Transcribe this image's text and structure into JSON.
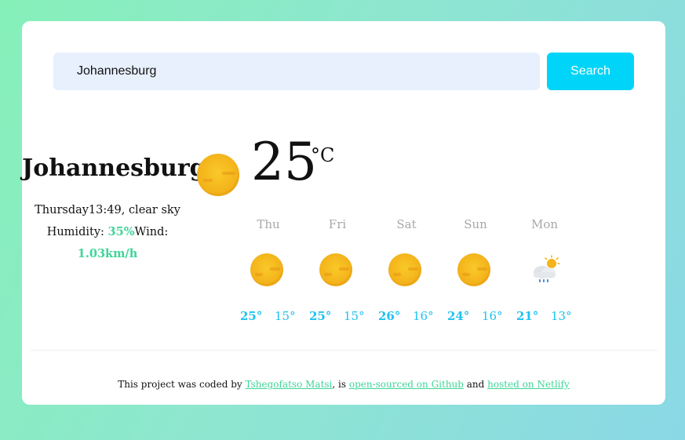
{
  "search": {
    "value": "Johannesburg",
    "placeholder": "",
    "button_label": "Search"
  },
  "current": {
    "city": "Johannesburg",
    "datetime_desc": "Thursday13:49, clear sky",
    "humidity_label": "Humidity: ",
    "humidity_value": "35%",
    "wind_label": "Wind:",
    "wind_value": "1.03km/h",
    "temperature": "25",
    "unit": "°C",
    "icon": "sun-icon"
  },
  "forecast": [
    {
      "day": "Thu",
      "high": "25°",
      "low": "15°",
      "icon": "sun-icon"
    },
    {
      "day": "Fri",
      "high": "25°",
      "low": "15°",
      "icon": "sun-icon"
    },
    {
      "day": "Sat",
      "high": "26°",
      "low": "16°",
      "icon": "sun-icon"
    },
    {
      "day": "Sun",
      "high": "24°",
      "low": "16°",
      "icon": "sun-icon"
    },
    {
      "day": "Mon",
      "high": "21°",
      "low": "13°",
      "icon": "cloud-rain-sun-icon"
    }
  ],
  "footer": {
    "prefix": "This project was coded by ",
    "author_link": "Tshegofatso Matsi",
    "middle": ", is ",
    "github_link": "open-sourced on Github",
    "and_text": " and ",
    "netlify_link": "hosted on Netlify"
  },
  "colors": {
    "accent": "#00d5f9",
    "green": "#3ed598",
    "temp_blue": "#1fc2f0",
    "input_bg": "#e8f0fe"
  }
}
